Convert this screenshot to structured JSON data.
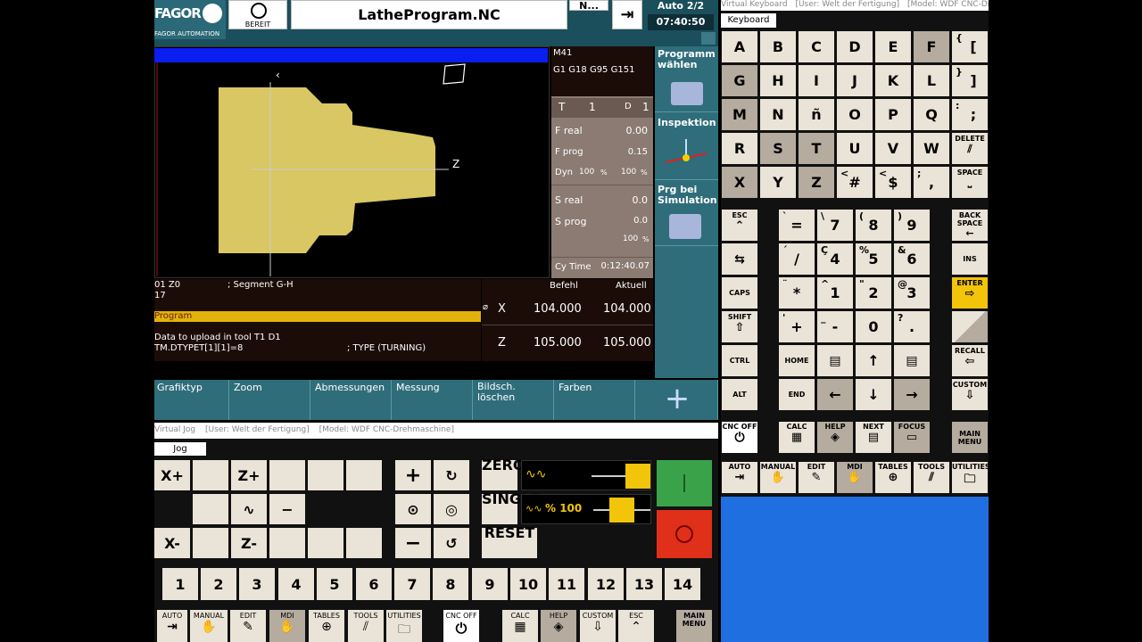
{
  "header": {
    "brand": "FAGOR",
    "brand_sub": "FAGOR AUTOMATION",
    "status_label": "BEREIT",
    "program": "LatheProgram.NC",
    "mode_short": "N...",
    "auto": "Auto 2/2",
    "time": "07:40:50"
  },
  "status": {
    "m_code": "M41",
    "g_codes": "G1 G18 G95 G151",
    "tool_label": "T",
    "tool": "1",
    "d_label": "D",
    "d": "1",
    "f_real_label": "F real",
    "f_real": "0.00",
    "f_prog_label": "F prog",
    "f_prog": "0.15",
    "dyn_label": "Dyn",
    "dyn1": "100",
    "dyn2": "100",
    "pct": "%",
    "s_real_label": "S real",
    "s_real": "0.0",
    "s_prog_label": "S prog",
    "s_prog": "0.0",
    "s_pct": "100",
    "cy_label": "Cy Time",
    "cy_time": "0:12:40.07"
  },
  "side_menu": [
    {
      "label": "Programm wählen"
    },
    {
      "label": "Inspektion"
    },
    {
      "label": "Prg bei Simulation"
    }
  ],
  "graphic": {
    "axis_z": "Z"
  },
  "program_lines": {
    "line1a": "01 Z0",
    "line1b": "; Segment G-H",
    "line2": "17",
    "bar": "Program",
    "msg1": "Data to upload in tool T1 D1",
    "msg2": "TM.DTYPET[1][1]=8",
    "msg2b": "; TYPE (TURNING)"
  },
  "axes": {
    "col_cmd": "Befehl",
    "col_act": "Aktuell",
    "rows": [
      {
        "name": "X",
        "cmd": "104.000",
        "act": "104.000"
      },
      {
        "name": "Z",
        "cmd": "105.000",
        "act": "105.000"
      }
    ]
  },
  "softkeys": [
    "Grafiktyp",
    "Zoom",
    "Abmessungen",
    "Messung",
    "Bildsch. löschen",
    "Farben",
    "+"
  ],
  "jog_window": {
    "title": "Virtual Jog",
    "user": "[User: Welt der Fertigung]",
    "model": "[Model: WDF CNC-Drehmaschine]",
    "tab": "Jog"
  },
  "jog": {
    "xplus": "X+",
    "zplus": "Z+",
    "xminus": "X-",
    "zminus": "Z-",
    "minus": "−",
    "plus": "+",
    "zero": "ZERO",
    "single": "SINGLE",
    "reset": "RESET",
    "feed": "% 100",
    "numbers": [
      "1",
      "2",
      "3",
      "4",
      "5",
      "6",
      "7",
      "8",
      "9",
      "10",
      "11",
      "12",
      "13",
      "14"
    ]
  },
  "bottom_keys": [
    "AUTO",
    "MANUAL",
    "EDIT",
    "MDI",
    "TABLES",
    "TOOLS",
    "UTILITIES",
    "CNC OFF",
    "CALC",
    "HELP",
    "CUSTOM",
    "ESC",
    "MAIN MENU"
  ],
  "kb_window": {
    "title": "Virtual Keyboard",
    "user": "[User: Welt der Fertigung]",
    "model": "[Model: WDF CNC-Dre...",
    "tab": "Keyboard"
  },
  "kb": {
    "letters": [
      "A",
      "B",
      "C",
      "D",
      "E",
      "F",
      "G",
      "H",
      "I",
      "J",
      "K",
      "L",
      "M",
      "N",
      "ñ",
      "O",
      "P",
      "Q",
      "R",
      "S",
      "T",
      "U",
      "V",
      "W",
      "X",
      "Y",
      "Z"
    ],
    "r5": [
      "#",
      "$",
      ","
    ],
    "r5sup": [
      "<",
      "<",
      ";"
    ],
    "brackets": [
      "[",
      "]",
      ";"
    ],
    "brsup": [
      "{",
      "}",
      ":"
    ],
    "delete": "DELETE",
    "space": "SPACE",
    "esc": "ESC",
    "backspace": "BACK SPACE",
    "ins": "INS",
    "caps": "CAPS",
    "enter": "ENTER",
    "shift": "SHIFT",
    "ctrl": "CTRL",
    "home": "HOME",
    "alt": "ALT",
    "end": "END",
    "recall": "RECALL",
    "custom": "CUSTOM",
    "num": [
      [
        "=",
        "7",
        "8",
        "9"
      ],
      [
        "/",
        "4",
        "5",
        "6"
      ],
      [
        "*",
        "1",
        "2",
        "3"
      ],
      [
        "+",
        "-",
        "0",
        "."
      ]
    ],
    "numsup": [
      [
        "`",
        "\\",
        "(",
        ")"
      ],
      [
        "´",
        "Ç",
        "%",
        "&"
      ],
      [
        "¨",
        "^",
        "\"",
        "@"
      ],
      [
        "'",
        "_",
        "",
        "?"
      ]
    ],
    "cncoff": "CNC OFF",
    "calc": "CALC",
    "help": "HELP",
    "next": "NEXT",
    "focus": "FOCUS",
    "mainmenu": "MAIN MENU",
    "bottom": [
      "AUTO",
      "MANUAL",
      "EDIT",
      "MDI",
      "TABLES",
      "TOOLS",
      "UTILITIES"
    ]
  },
  "colors": {
    "teal": "#2f6d7a",
    "key": "#eae3d7",
    "key_dark": "#b5ab9f",
    "part": "#d8c763",
    "start": "#3aa34a",
    "stop": "#e0301a",
    "enter": "#f2c40a",
    "desktop": "#1f6fe0"
  }
}
